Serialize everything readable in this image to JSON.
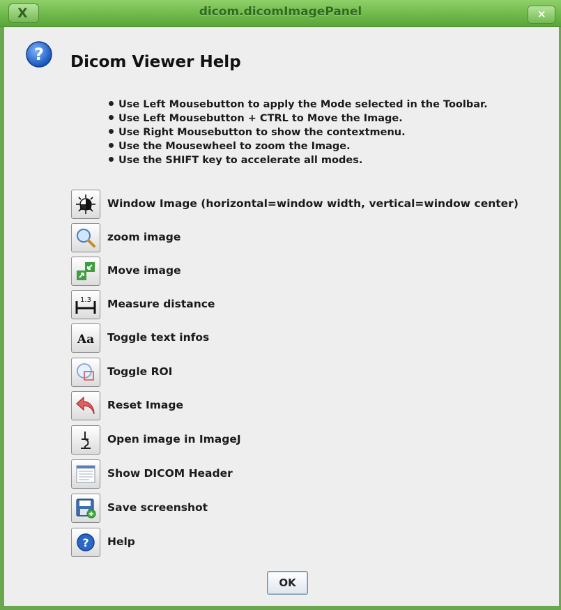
{
  "window": {
    "title": "dicom.dicomImagePanel",
    "menu_glyph": "X",
    "close_glyph": "×"
  },
  "header": {
    "icon": "help-icon",
    "title": "Dicom Viewer Help"
  },
  "instructions": [
    "Use Left Mousebutton to apply the Mode selected in the Toolbar.",
    "Use Left Mousebutton + CTRL to Move the Image.",
    "Use Right Mousebutton to show the contextmenu.",
    "Use the Mousewheel to zoom the Image.",
    "Use the SHIFT key to accelerate all modes."
  ],
  "tools": [
    {
      "icon": "window-level-icon",
      "label": "Window Image (horizontal=window width, vertical=window center)"
    },
    {
      "icon": "zoom-icon",
      "label": "zoom image"
    },
    {
      "icon": "move-icon",
      "label": "Move image"
    },
    {
      "icon": "measure-icon",
      "label": "Measure distance",
      "icon_text": "1.3"
    },
    {
      "icon": "text-icon",
      "label": "Toggle text infos",
      "icon_text": "Aa"
    },
    {
      "icon": "roi-icon",
      "label": "Toggle ROI"
    },
    {
      "icon": "reset-icon",
      "label": "Reset Image"
    },
    {
      "icon": "microscope-icon",
      "label": "Open image in ImageJ"
    },
    {
      "icon": "header-icon",
      "label": "Show DICOM Header"
    },
    {
      "icon": "save-icon",
      "label": "Save screenshot"
    },
    {
      "icon": "help-icon",
      "label": "Help"
    }
  ],
  "footer": {
    "ok_label": "OK"
  },
  "colors": {
    "titlebar": "#6fb94a",
    "window_border": "#6aa84f",
    "background": "#eeeeee"
  }
}
